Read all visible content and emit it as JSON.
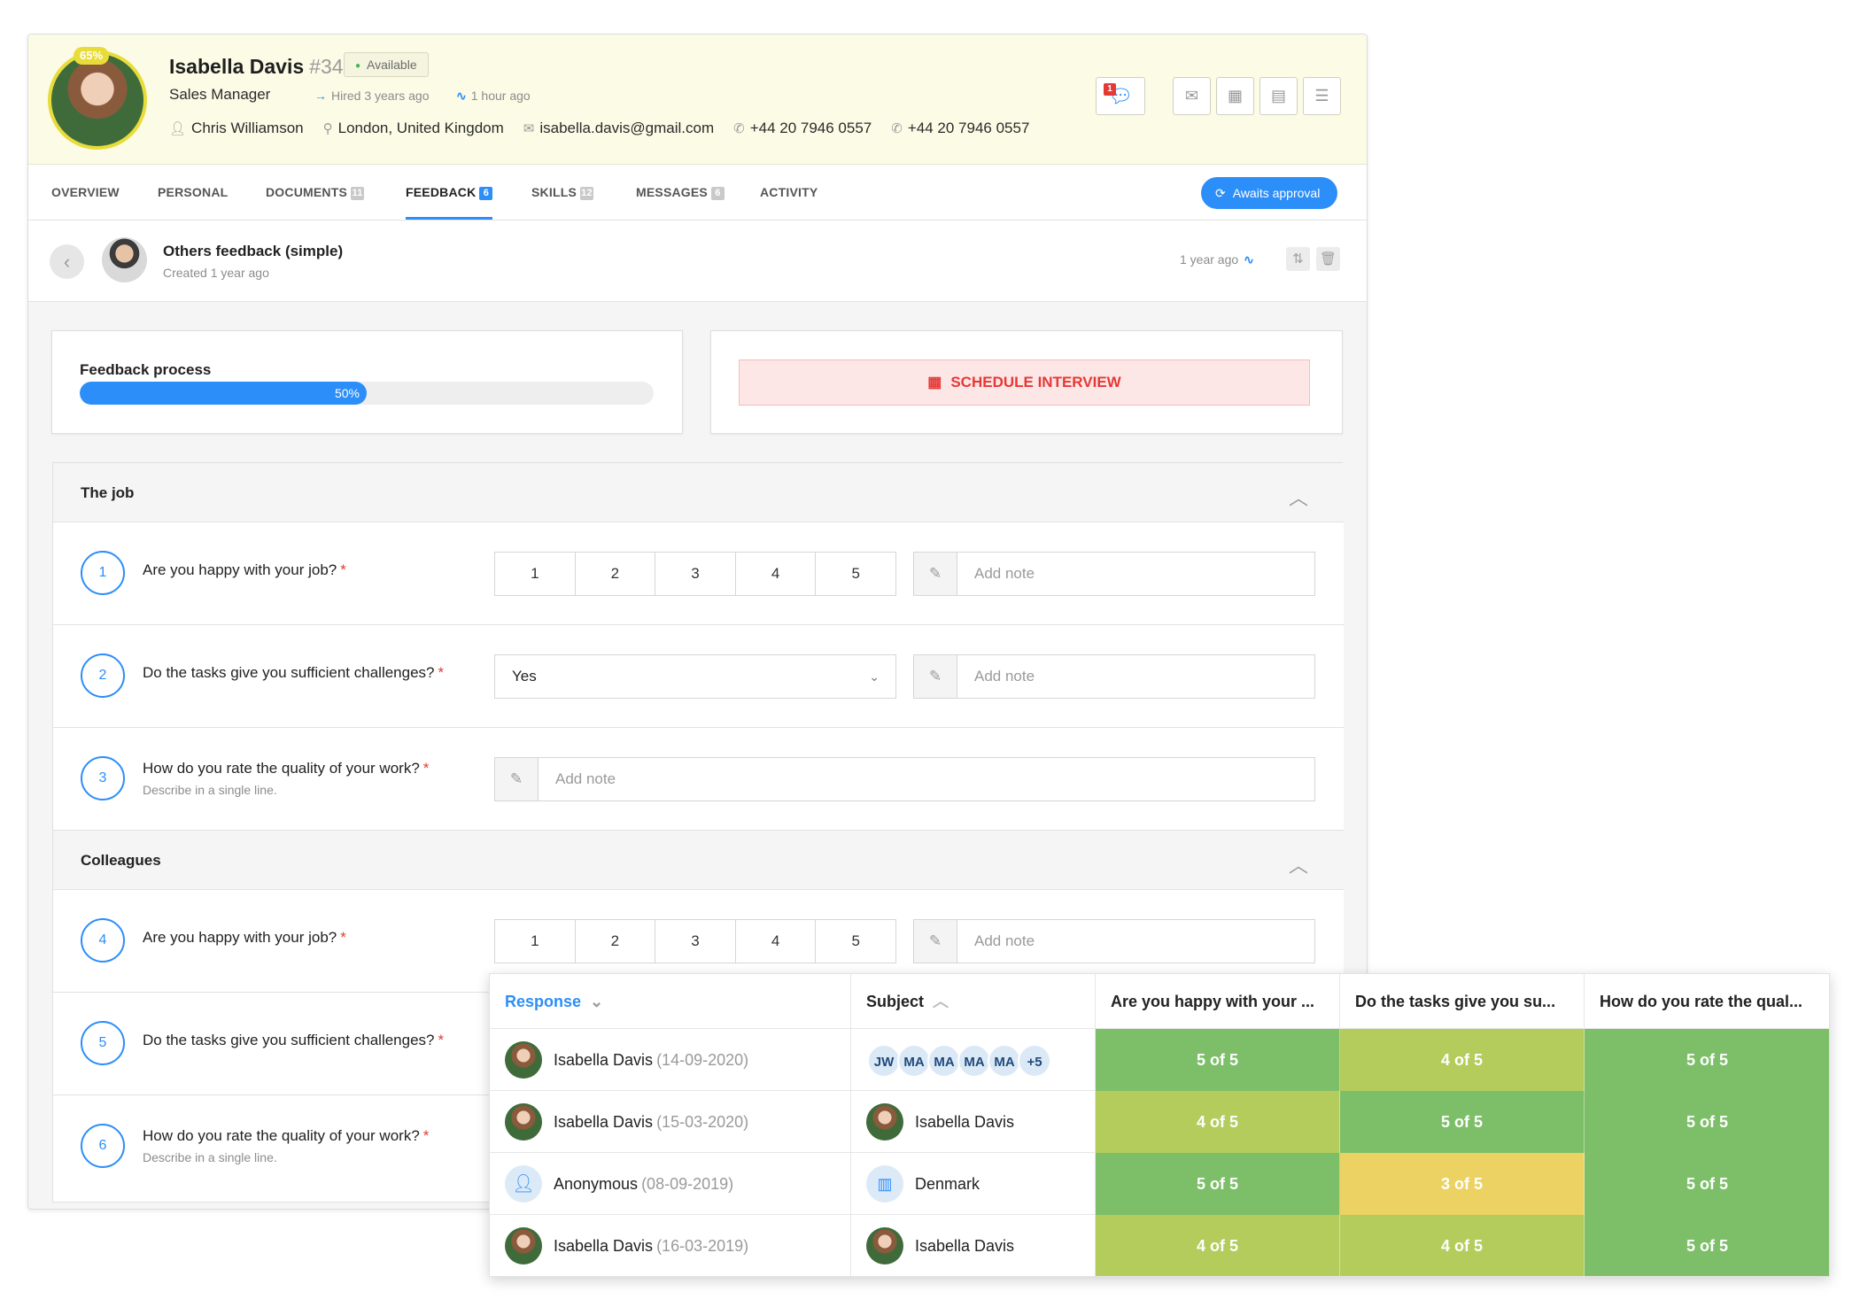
{
  "colors": {
    "accent": "#2c8ef8",
    "score_5": "#7dbf68",
    "score_4": "#b3cc5c",
    "score_3": "#ecd262",
    "danger": "#e53935"
  },
  "profile": {
    "completion": "65%",
    "name": "Isabella Davis",
    "id": "#34",
    "status": "Available",
    "role": "Sales Manager",
    "hired": "Hired 3 years ago",
    "active": "1 hour ago",
    "contacts": [
      "Chris Williamson",
      "London, United Kingdom",
      "isabella.davis@gmail.com",
      "+44 20 7946 0557",
      "+44 20 7946 0557"
    ],
    "chat_badge": "1"
  },
  "tabs": [
    {
      "label": "OVERVIEW",
      "count": ""
    },
    {
      "label": "PERSONAL",
      "count": ""
    },
    {
      "label": "DOCUMENTS",
      "count": "11"
    },
    {
      "label": "FEEDBACK",
      "count": "6"
    },
    {
      "label": "SKILLS",
      "count": "12"
    },
    {
      "label": "MESSAGES",
      "count": "6"
    },
    {
      "label": "ACTIVITY",
      "count": ""
    }
  ],
  "approval_label": "Awaits approval",
  "feedback": {
    "title": "Others feedback (simple)",
    "created": "Created 1 year ago",
    "time": "1 year ago"
  },
  "progress": {
    "label": "Feedback process",
    "value": 0.5,
    "text": "50%"
  },
  "schedule_label": "SCHEDULE INTERVIEW",
  "sections": [
    {
      "title": "The job",
      "questions": [
        {
          "num": "1",
          "text": "Are you happy with your job?",
          "hint": "",
          "type": "rating"
        },
        {
          "num": "2",
          "text": "Do the tasks give you sufficient challenges?",
          "hint": "",
          "type": "select",
          "value": "Yes"
        },
        {
          "num": "3",
          "text": "How do you rate the quality of your work?",
          "hint": "Describe in a single line.",
          "type": "note"
        }
      ]
    },
    {
      "title": "Colleagues",
      "questions": [
        {
          "num": "4",
          "text": "Are you happy with your job?",
          "hint": "",
          "type": "rating"
        },
        {
          "num": "5",
          "text": "Do the tasks give you sufficient challenges?",
          "hint": "",
          "type": "select"
        },
        {
          "num": "6",
          "text": "How do you rate the quality of your work?",
          "hint": "Describe in a single line.",
          "type": "note"
        }
      ]
    }
  ],
  "rating_options": [
    "1",
    "2",
    "3",
    "4",
    "5"
  ],
  "note_placeholder": "Add note",
  "table": {
    "headers": [
      "Response",
      "Subject",
      "Are you happy with your ...",
      "Do the tasks give you su...",
      "How do you rate the qual..."
    ],
    "rows": [
      {
        "response": "Isabella Davis",
        "date": "(14-09-2020)",
        "subject": "",
        "chips": [
          "JW",
          "MA",
          "MA",
          "MA",
          "MA",
          "+5"
        ],
        "scores": [
          "5 of 5",
          "4 of 5",
          "5 of 5"
        ]
      },
      {
        "response": "Isabella Davis",
        "date": "(15-03-2020)",
        "subject": "Isabella Davis",
        "chips": [],
        "scores": [
          "4 of 5",
          "5 of 5",
          "5 of 5"
        ]
      },
      {
        "response": "Anonymous",
        "date": "(08-09-2019)",
        "subject": "Denmark",
        "chips": [],
        "scores": [
          "5 of 5",
          "3 of 5",
          "5 of 5"
        ]
      },
      {
        "response": "Isabella Davis",
        "date": "(16-03-2019)",
        "subject": "Isabella Davis",
        "chips": [],
        "scores": [
          "4 of 5",
          "4 of 5",
          "5 of 5"
        ]
      }
    ]
  }
}
